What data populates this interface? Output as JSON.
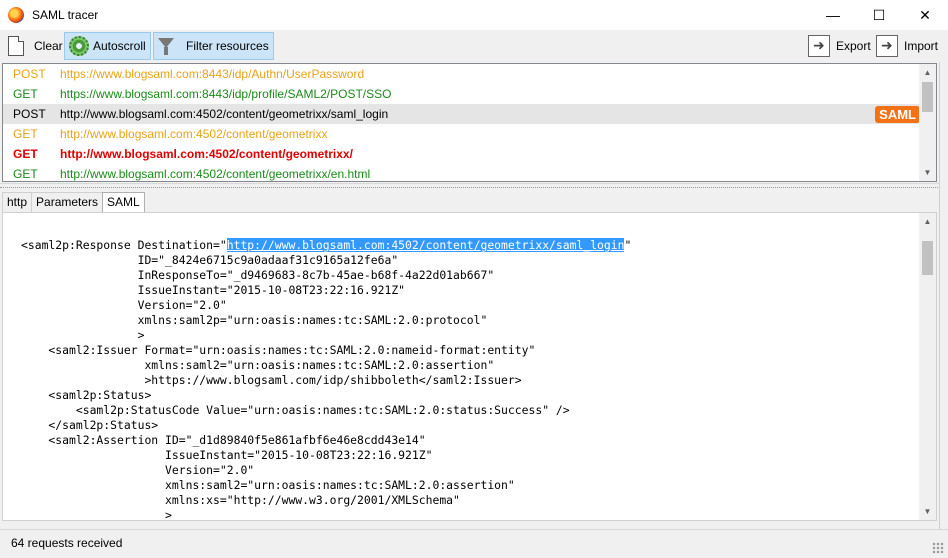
{
  "window": {
    "title": "SAML tracer",
    "minimize": "—",
    "maximize": "☐",
    "close": "✕"
  },
  "toolbar": {
    "clear": "Clear",
    "autoscroll": "Autoscroll",
    "filter": "Filter resources",
    "export": "Export",
    "import": "Import"
  },
  "requests": [
    {
      "method": "POST",
      "url": "https://www.blogsaml.com:8443/idp/Authn/UserPassword",
      "color": "#e8a317"
    },
    {
      "method": "GET",
      "url": "https://www.blogsaml.com:8443/idp/profile/SAML2/POST/SSO",
      "color": "#1a8a1a"
    },
    {
      "method": "POST",
      "url": "http://www.blogsaml.com:4502/content/geometrixx/saml_login",
      "color": "#000000",
      "badge": "SAML"
    },
    {
      "method": "GET",
      "url": "http://www.blogsaml.com:4502/content/geometrixx",
      "color": "#e8a317"
    },
    {
      "method": "GET",
      "url": "http://www.blogsaml.com:4502/content/geometrixx/",
      "color": "#e00000"
    },
    {
      "method": "GET",
      "url": "http://www.blogsaml.com:4502/content/geometrixx/en.html",
      "color": "#1a8a1a"
    }
  ],
  "tabs": [
    "http",
    "Parameters",
    "SAML"
  ],
  "xml": {
    "l1_pre": "<saml2p:Response Destination=\"",
    "l1_hl": "http://www.blogsaml.com:4502/content/geometrixx/saml_login",
    "l1_post": "\"",
    "rest": "                 ID=\"_8424e6715c9a0adaaf31c9165a12fe6a\"\n                 InResponseTo=\"_d9469683-8c7b-45ae-b68f-4a22d01ab667\"\n                 IssueInstant=\"2015-10-08T23:22:16.921Z\"\n                 Version=\"2.0\"\n                 xmlns:saml2p=\"urn:oasis:names:tc:SAML:2.0:protocol\"\n                 >\n    <saml2:Issuer Format=\"urn:oasis:names:tc:SAML:2.0:nameid-format:entity\"\n                  xmlns:saml2=\"urn:oasis:names:tc:SAML:2.0:assertion\"\n                  >https://www.blogsaml.com/idp/shibboleth</saml2:Issuer>\n    <saml2p:Status>\n        <saml2p:StatusCode Value=\"urn:oasis:names:tc:SAML:2.0:status:Success\" />\n    </saml2p:Status>\n    <saml2:Assertion ID=\"_d1d89840f5e861afbf6e46e8cdd43e14\"\n                     IssueInstant=\"2015-10-08T23:22:16.921Z\"\n                     Version=\"2.0\"\n                     xmlns:saml2=\"urn:oasis:names:tc:SAML:2.0:assertion\"\n                     xmlns:xs=\"http://www.w3.org/2001/XMLSchema\"\n                     >"
  },
  "status": "64 requests received"
}
